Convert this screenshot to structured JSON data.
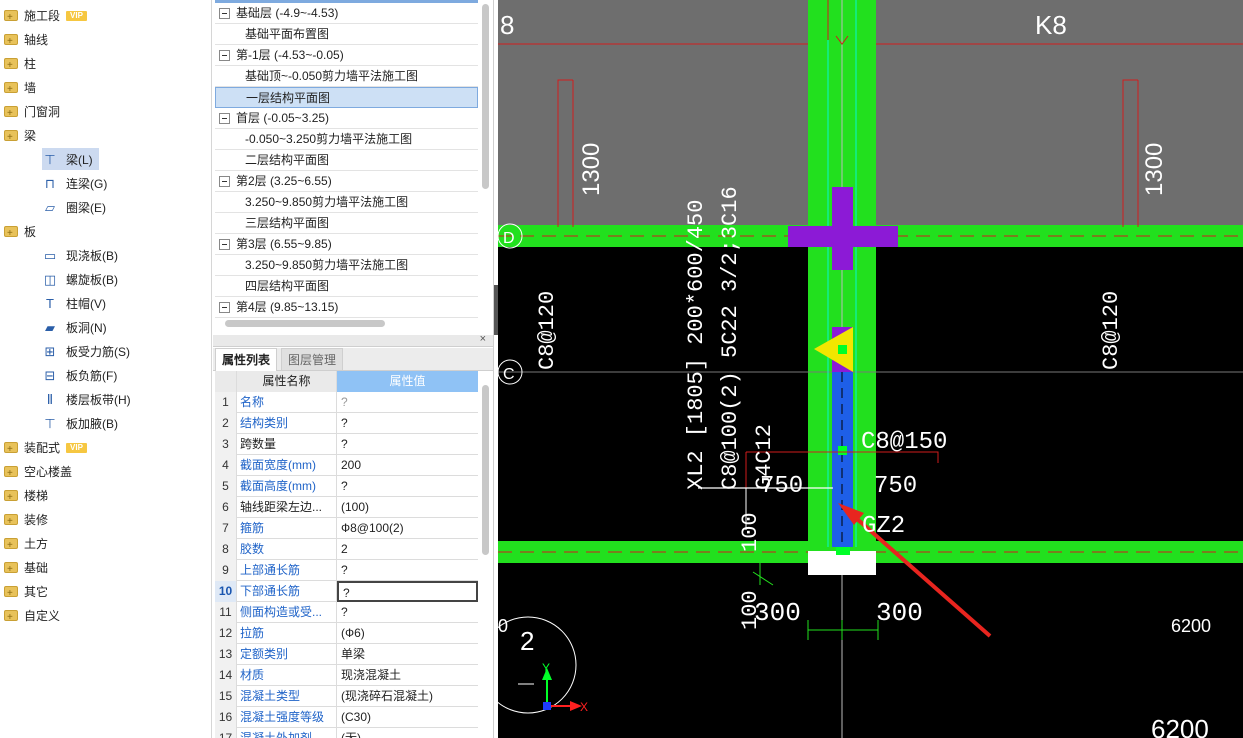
{
  "tree": {
    "categories": [
      {
        "label": "施工段",
        "vip": "VIP"
      },
      {
        "label": "轴线"
      },
      {
        "label": "柱"
      },
      {
        "label": "墙"
      },
      {
        "label": "门窗洞"
      },
      {
        "label": "梁"
      },
      {
        "label": "板"
      },
      {
        "label": "装配式",
        "vip": "VIP"
      },
      {
        "label": "空心楼盖"
      },
      {
        "label": "楼梯"
      },
      {
        "label": "装修"
      },
      {
        "label": "土方"
      },
      {
        "label": "基础"
      },
      {
        "label": "其它"
      },
      {
        "label": "自定义"
      }
    ],
    "beam_items": [
      "梁(L)",
      "连梁(G)",
      "圈梁(E)"
    ],
    "slab_items": [
      "现浇板(B)",
      "螺旋板(B)",
      "柱帽(V)",
      "板洞(N)",
      "板受力筋(S)",
      "板负筋(F)",
      "楼层板带(H)",
      "板加腋(B)"
    ]
  },
  "floors": [
    {
      "type": "group",
      "label": "基础层 (-4.9~-4.53)"
    },
    {
      "type": "child",
      "label": "基础平面布置图"
    },
    {
      "type": "group",
      "label": "第-1层 (-4.53~-0.05)"
    },
    {
      "type": "child",
      "label": "基础顶~-0.050剪力墙平法施工图"
    },
    {
      "type": "child",
      "label": "一层结构平面图",
      "selected": true
    },
    {
      "type": "group",
      "label": "首层 (-0.05~3.25)"
    },
    {
      "type": "child",
      "label": "-0.050~3.250剪力墙平法施工图"
    },
    {
      "type": "child",
      "label": "二层结构平面图"
    },
    {
      "type": "group",
      "label": "第2层 (3.25~6.55)"
    },
    {
      "type": "child",
      "label": "3.250~9.850剪力墙平法施工图"
    },
    {
      "type": "child",
      "label": "三层结构平面图"
    },
    {
      "type": "group",
      "label": "第3层 (6.55~9.85)"
    },
    {
      "type": "child",
      "label": "3.250~9.850剪力墙平法施工图"
    },
    {
      "type": "child",
      "label": "四层结构平面图"
    },
    {
      "type": "group",
      "label": "第4层 (9.85~13.15)"
    }
  ],
  "props": {
    "close": "×",
    "tabs": [
      "属性列表",
      "图层管理"
    ],
    "headers": {
      "name": "属性名称",
      "value": "属性值"
    },
    "rows": [
      {
        "idx": "1",
        "name": "名称",
        "value": "?",
        "blue": true,
        "placeholder": true
      },
      {
        "idx": "2",
        "name": "结构类别",
        "value": "?",
        "blue": true
      },
      {
        "idx": "3",
        "name": "跨数量",
        "value": "?"
      },
      {
        "idx": "4",
        "name": "截面宽度(mm)",
        "value": "200",
        "blue": true
      },
      {
        "idx": "5",
        "name": "截面高度(mm)",
        "value": "?",
        "blue": true
      },
      {
        "idx": "6",
        "name": "轴线距梁左边...",
        "value": "(100)"
      },
      {
        "idx": "7",
        "name": "箍筋",
        "value": "Ф8@100(2)",
        "blue": true
      },
      {
        "idx": "8",
        "name": "胶数",
        "value": "2",
        "blue": true
      },
      {
        "idx": "9",
        "name": "上部通长筋",
        "value": "?",
        "blue": true
      },
      {
        "idx": "10",
        "name": "下部通长筋",
        "value": "?",
        "blue": true,
        "current": true
      },
      {
        "idx": "11",
        "name": "侧面构造或受...",
        "value": "?",
        "blue": true
      },
      {
        "idx": "12",
        "name": "拉筋",
        "value": "(Ф6)",
        "blue": true
      },
      {
        "idx": "13",
        "name": "定额类别",
        "value": "单梁",
        "blue": true
      },
      {
        "idx": "14",
        "name": "材质",
        "value": "现浇混凝土",
        "blue": true
      },
      {
        "idx": "15",
        "name": "混凝土类型",
        "value": "(现浇碎石混凝土)",
        "blue": true
      },
      {
        "idx": "16",
        "name": "混凝土强度等级",
        "value": "(C30)",
        "blue": true
      },
      {
        "idx": "17",
        "name": "混凝土外加剂",
        "value": "(无)",
        "blue": true
      }
    ]
  },
  "cad": {
    "colors": {
      "wall": "#22e01e",
      "purple": "#8c1ad6",
      "beam": "#1e5fe8",
      "axis_red": "#d11d1d",
      "grid_gray": "#6e6e6e"
    },
    "texts": {
      "k8": "K8",
      "top_left_num": "8",
      "dim_1300_left": "1300",
      "dim_1300_right": "1300",
      "axis_d": "D",
      "axis_c": "C",
      "c8_120_left": "C8@120",
      "c8_120_right": "C8@120",
      "beam_label_1": "XL2 [1805] 200*600/450",
      "beam_label_2": "C8@100(2) 5C22 3/2;3C16",
      "beam_label_3": "G4C12",
      "c8_150": "C8@150",
      "dim_750_left": "750",
      "dim_750_right": "750",
      "gz2": "GZ2",
      "dim_100_a": "100",
      "dim_100_b": "100",
      "dim_300_left": "300",
      "dim_300_right": "300",
      "dim_6200": "6200",
      "dim_6200_b": "6200",
      "circle_2": "2",
      "ucs_y": "Y",
      "ucs_x": "X",
      "left_edge_0": "0"
    }
  }
}
